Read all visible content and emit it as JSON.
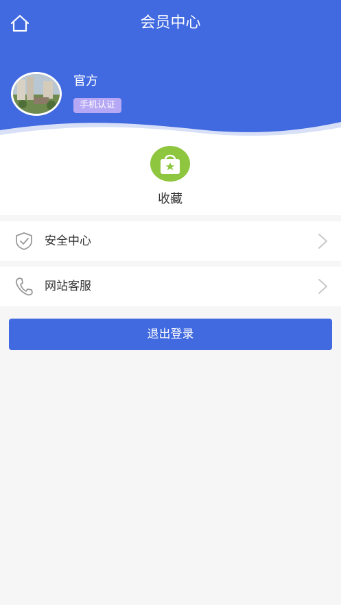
{
  "header": {
    "title": "会员中心",
    "home_icon": "home-icon"
  },
  "profile": {
    "name": "官方",
    "badge": "手机认证"
  },
  "favorites": {
    "label": "收藏",
    "icon": "shopping-bag-star-icon",
    "color": "#8ec63f"
  },
  "menu": [
    {
      "label": "安全中心",
      "icon": "shield-check-icon"
    },
    {
      "label": "网站客服",
      "icon": "phone-icon"
    }
  ],
  "logout": {
    "label": "退出登录"
  },
  "colors": {
    "primary": "#4169e0",
    "badge": "#b7a8f5",
    "background": "#f6f6f6"
  }
}
